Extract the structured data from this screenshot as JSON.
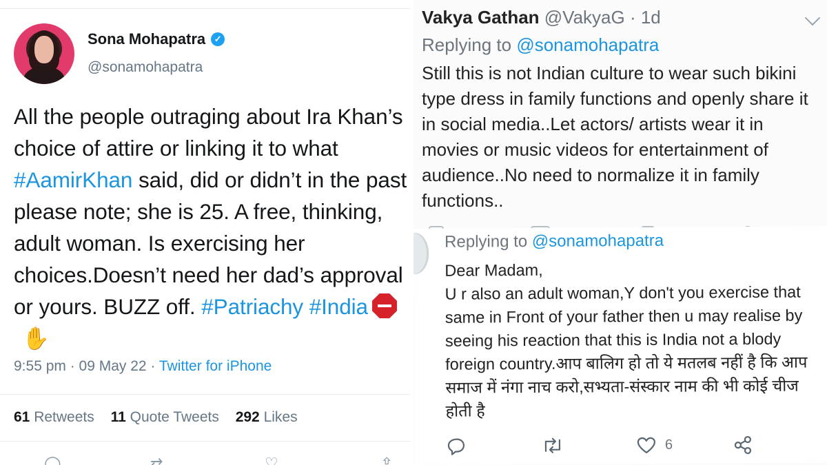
{
  "left_tweet": {
    "author_name": "Sona Mohapatra",
    "author_handle": "@sonamohapatra",
    "body": [
      {
        "text": "All the people outraging about Ira Khan’s choice of attire or linking it to what ",
        "tag": false
      },
      {
        "text": "#AamirKhan",
        "tag": true
      },
      {
        "text": " said, did or didn’t in the past please note; she is 25. A free, thinking, adult woman. Is exercising her choices.Doesn’t need her dad’s approval or yours. BUZZ off. ",
        "tag": false
      },
      {
        "text": "#Patriachy",
        "tag": true
      },
      {
        "text": " ",
        "tag": false
      },
      {
        "text": "#India",
        "tag": true
      }
    ],
    "emojis": [
      "stop-sign-emoji",
      "raised-hand-emoji"
    ],
    "timestamp": "9:55 pm · 09 May 22 · ",
    "source": "Twitter for iPhone",
    "stats": {
      "retweets_count": "61",
      "retweets_label": "Retweets",
      "quotes_count": "11",
      "quotes_label": "Quote Tweets",
      "likes_count": "292",
      "likes_label": "Likes"
    },
    "action_icons": [
      "reply-icon",
      "retweet-icon",
      "like-icon",
      "share-icon"
    ]
  },
  "right_tweet_top": {
    "author_name": "Vakya Gathan",
    "author_handle": "@VakyaG",
    "age": "· 1d",
    "replying_prefix": "Replying to ",
    "replying_handle": "@sonamohapatra",
    "body": "Still this is not Indian culture to wear such bikini type dress in family functions and openly share it in social media..Let actors/ artists wear it in movies or music videos for entertainment of audience..No need to normalize it in family functions.."
  },
  "right_tweet_bottom": {
    "replying_prefix": "Replying to ",
    "replying_handle": "@sonamohapatra",
    "body": "Dear Madam,\nU r also an adult woman,Y don't you exercise that same in Front of your father then u may realise by seeing his reaction that this is India not a blody foreign country.आप बालिग हो तो ये मतलब नहीं है कि आप समाज में नंगा नाच करो,सभ्यता-संस्कार नाम की भी कोई चीज होती है",
    "like_count": "6",
    "action_icons": [
      "reply-icon",
      "retweet-icon",
      "like-icon",
      "share-icon"
    ]
  },
  "colors": {
    "link": "#1b95e0",
    "verified": "#1da1f2",
    "muted": "#657786",
    "text": "#14171a"
  }
}
